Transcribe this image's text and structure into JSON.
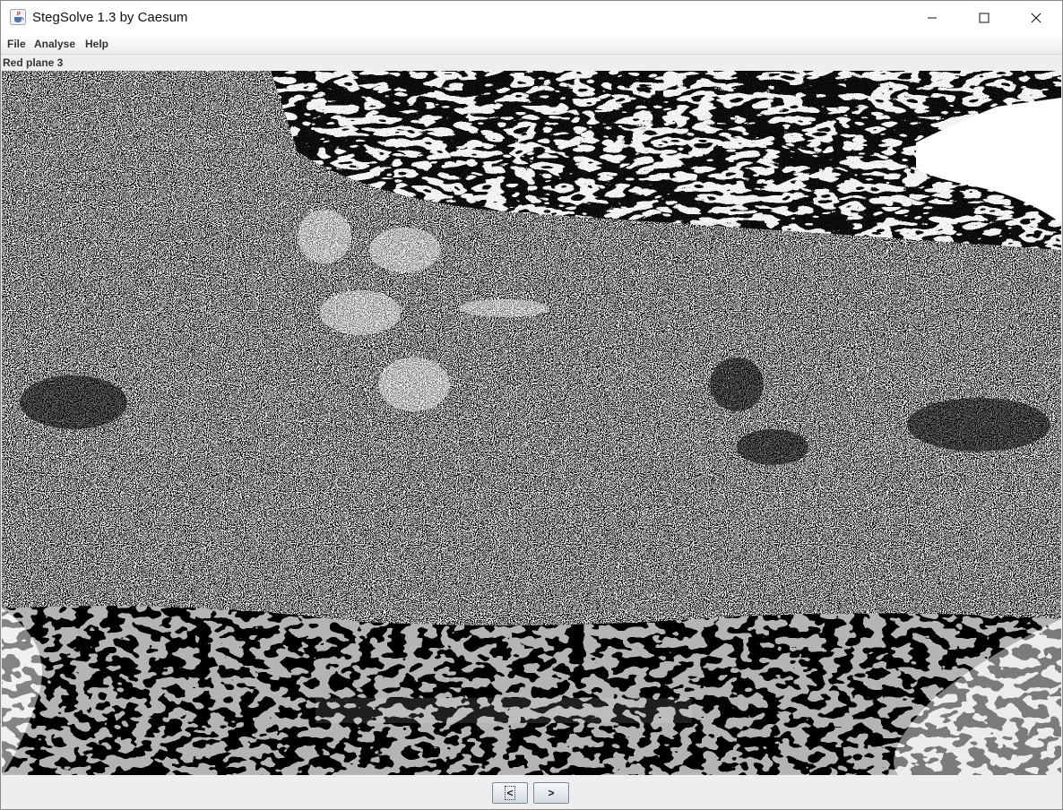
{
  "window": {
    "title": "StegSolve 1.3 by Caesum",
    "icon": "java-cup-icon",
    "controls": [
      "minimize-icon",
      "maximize-icon",
      "close-icon"
    ]
  },
  "menu": {
    "items": [
      {
        "label": "File"
      },
      {
        "label": "Analyse"
      },
      {
        "label": "Help"
      }
    ]
  },
  "plane_label": "Red plane 3",
  "nav": {
    "prev_label": "<",
    "next_label": ">"
  },
  "colors": {
    "black": "#000000",
    "white": "#ffffff",
    "chrome": "#eeeeee"
  }
}
